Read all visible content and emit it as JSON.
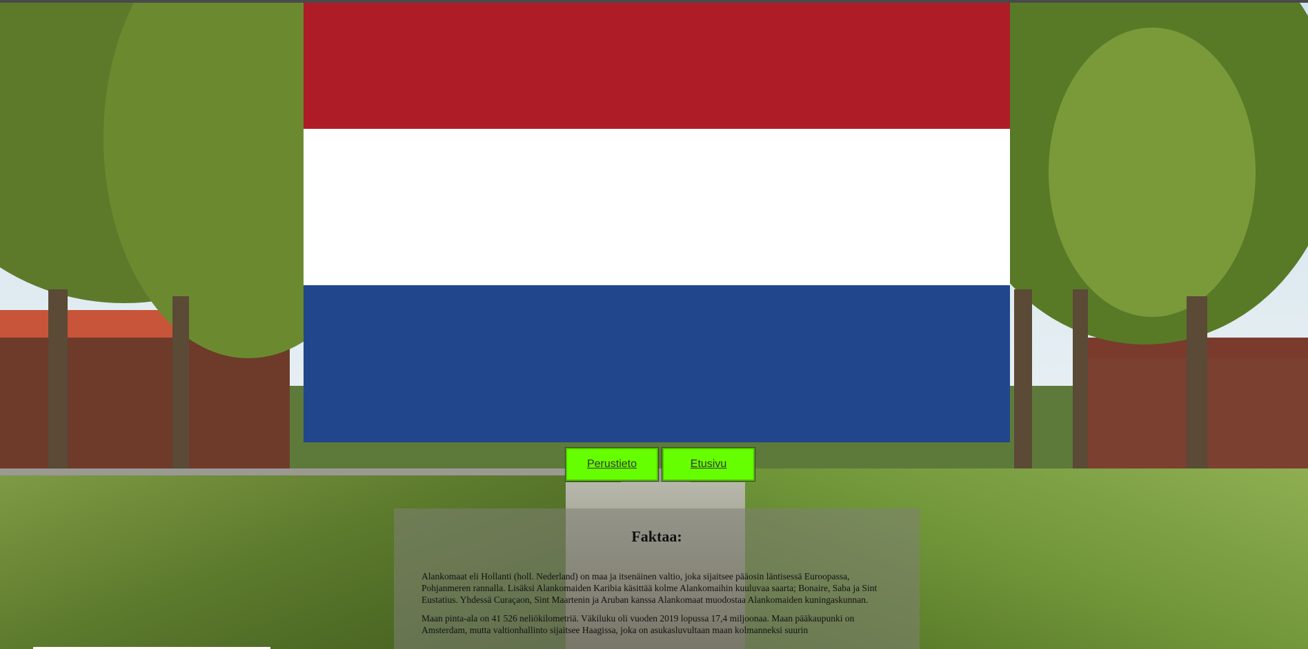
{
  "flag": {
    "country": "Netherlands",
    "colors": [
      "#ae1c28",
      "#ffffff",
      "#21468b"
    ]
  },
  "nav": {
    "items": [
      {
        "label": "Perustieto"
      },
      {
        "label": "Etusivu"
      }
    ],
    "button_color": "#66ff00"
  },
  "facts": {
    "title": "Faktaa:",
    "paragraphs": [
      "Alankomaat eli Hollanti (holl. Nederland) on maa ja itsenäinen valtio, joka sijaitsee pääosin läntisessä Euroopassa, Pohjanmeren rannalla. Lisäksi Alankomaiden Karibia käsittää kolme Alankomaihin kuuluvaa saarta; Bonaire, Saba ja Sint Eustatius. Yhdessä Curaçaon, Sint Maartenin ja Aruban kanssa Alankomaat muodostaa Alankomaiden kuningaskunnan.",
      "Maan pinta-ala on 41 526 neliökilometriä. Väkiluku oli vuoden 2019 lopussa 17,4 miljoonaa. Maan pääkaupunki on Amsterdam, mutta valtionhallinto sijaitsee Haagissa, joka on asukasluvultaan maan kolmanneksi suurin"
    ]
  }
}
